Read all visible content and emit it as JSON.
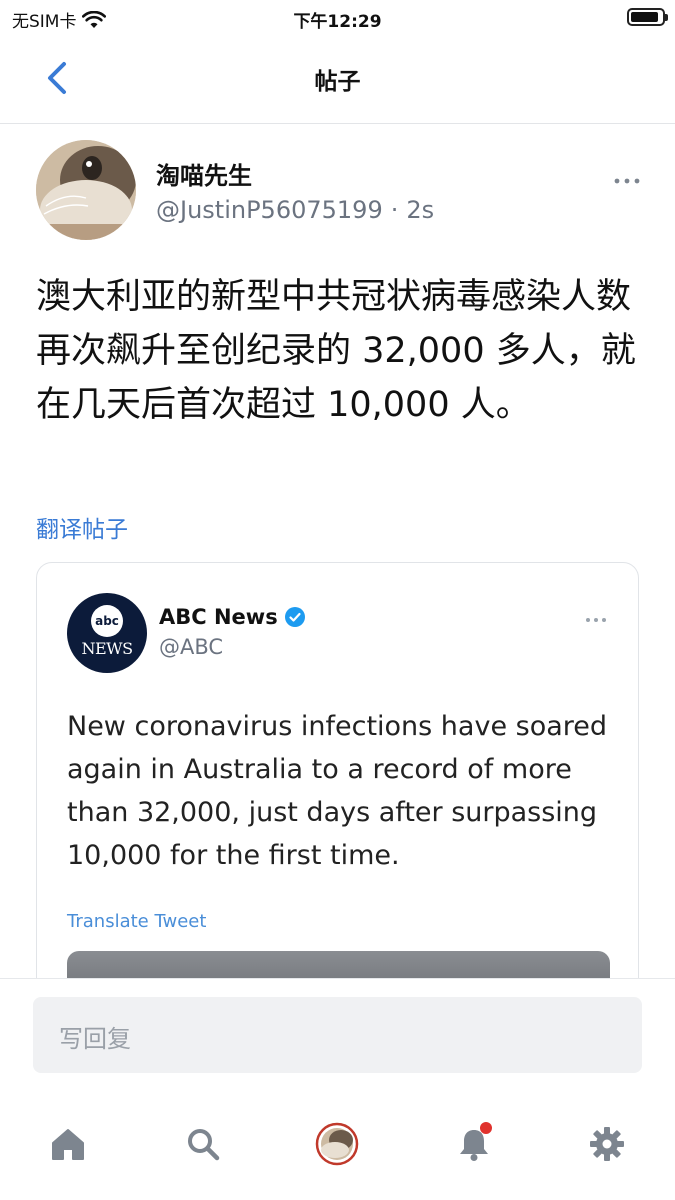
{
  "status_bar": {
    "carrier": "无SIM卡",
    "time": "下午12:29",
    "battery_level": 0.9
  },
  "nav": {
    "title": "帖子"
  },
  "post": {
    "display_name": "淘喵先生",
    "handle": "@JustinP56075199",
    "separator": "·",
    "time": "2s",
    "text": "澳大利亚的新型中共冠状病毒感染人数再次飙升至创纪录的 32,000 多人，就在几天后首次超过 10,000 人。",
    "translate_label": "翻译帖子"
  },
  "quoted": {
    "name": "ABC News",
    "handle": "@ABC",
    "logo_top": "abc",
    "logo_bottom": "NEWS",
    "text": "New coronavirus infections have soared again in Australia to a record of more than 32,000, just days after surpassing 10,000 for the first time.",
    "translate_label": "Translate Tweet",
    "verified_color": "#1d9bf0"
  },
  "reply": {
    "placeholder": "写回复"
  },
  "tabs": [
    {
      "icon": "home-icon"
    },
    {
      "icon": "search-icon"
    },
    {
      "icon": "profile-avatar-icon"
    },
    {
      "icon": "bell-icon",
      "badge": true
    },
    {
      "icon": "gear-icon"
    }
  ],
  "colors": {
    "accent": "#3a7bd5",
    "badge": "#e0322d",
    "icon_gray": "#7d858f"
  }
}
